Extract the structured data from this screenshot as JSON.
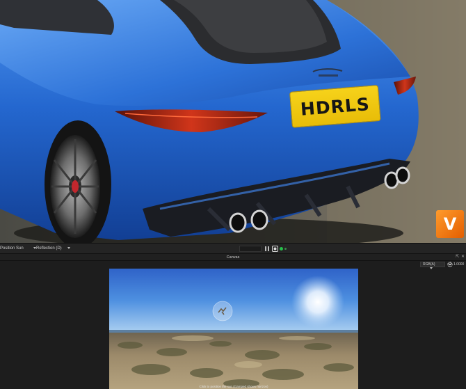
{
  "viewport": {
    "license_plate": "HDRLS",
    "badge_letter": "V",
    "colors": {
      "body": "#1f63c7",
      "plate": "#f4cd15",
      "badge": "#f27a12"
    }
  },
  "toolbar": {
    "position_mode": "Position Sun",
    "reflection": "Reflection (D)",
    "status_dot_color": "#26c04a"
  },
  "panel": {
    "title": "Canvas",
    "channel": "RGB(A)",
    "exposure": "1.0000",
    "hint": "Click to position the sun (Gamped shows horizon)"
  },
  "icons": [
    "panel-toggle-icon",
    "render-icon",
    "status-dot-icon",
    "pin-icon",
    "close-icon",
    "gear-icon",
    "sun-target-icon"
  ]
}
